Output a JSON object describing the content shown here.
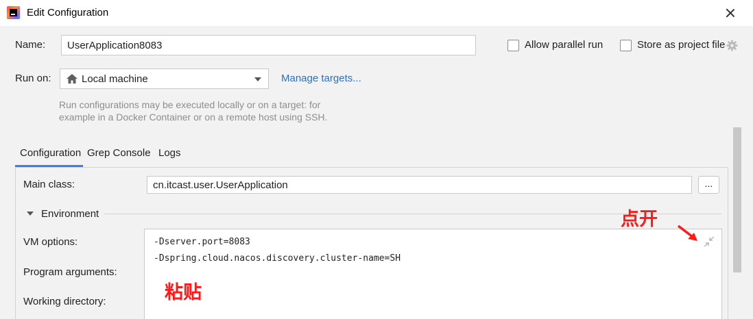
{
  "window": {
    "title": "Edit Configuration"
  },
  "name_row": {
    "label": "Name:",
    "value": "UserApplication8083",
    "allow_parallel_label": "Allow parallel run",
    "store_project_label": "Store as project file"
  },
  "run_on": {
    "label": "Run on:",
    "selected": "Local machine",
    "icon": "home-icon",
    "manage_link": "Manage targets...",
    "hint_line1": "Run configurations may be executed locally or on a target: for",
    "hint_line2": "example in a Docker Container or on a remote host using SSH."
  },
  "tabs": [
    {
      "label": "Configuration",
      "active": true
    },
    {
      "label": "Grep Console",
      "active": false
    },
    {
      "label": "Logs",
      "active": false
    }
  ],
  "config": {
    "main_class_label": "Main class:",
    "main_class_value": "cn.itcast.user.UserApplication",
    "browse_button": "...",
    "environment_label": "Environment",
    "vm_options_label": "VM options:",
    "vm_options_lines": [
      "-Dserver.port=8083",
      "-Dspring.cloud.nacos.discovery.cluster-name=SH"
    ],
    "program_args_label": "Program arguments:",
    "working_dir_label": "Working directory:"
  },
  "annotations": {
    "open_hint": "点开",
    "paste_hint": "粘贴",
    "color": "#ff1a1a"
  },
  "colors": {
    "link": "#2b70c3",
    "tab_underline": "#3f7ee0"
  }
}
